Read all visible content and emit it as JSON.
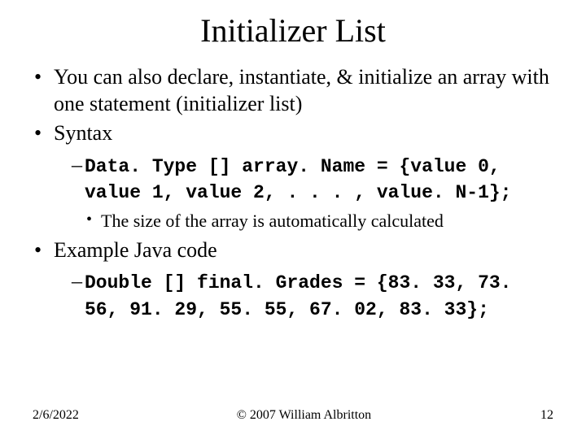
{
  "title": "Initializer List",
  "bullets": {
    "b1": "You can also declare, instantiate, & initialize an array with one statement (initializer list)",
    "b2": "Syntax",
    "b2_code": "Data. Type [] array. Name = {value 0, value 1, value 2, . . . , value. N-1};",
    "b2_note": "The size of the array is automatically calculated",
    "b3": "Example Java code",
    "b3_code": "Double [] final. Grades = {83. 33, 73. 56, 91. 29, 55. 55, 67. 02, 83. 33};"
  },
  "footer": {
    "date": "2/6/2022",
    "copyright": "© 2007 William Albritton",
    "page": "12"
  }
}
